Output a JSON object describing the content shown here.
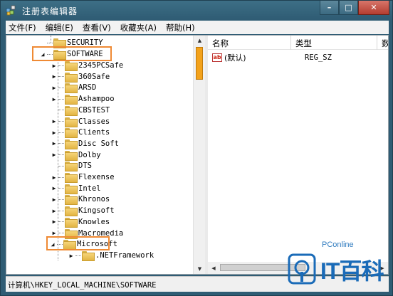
{
  "window": {
    "title": "注册表编辑器",
    "min_glyph": "–",
    "max_glyph": "□",
    "close_glyph": "✕"
  },
  "menu": [
    "文件(F)",
    "编辑(E)",
    "查看(V)",
    "收藏夹(A)",
    "帮助(H)"
  ],
  "tree": {
    "above": {
      "label": "SECURITY"
    },
    "software": {
      "label": "SOFTWARE",
      "expander": "◢"
    },
    "children": [
      "2345PCSafe",
      "360Safe",
      "ARSD",
      "Ashampoo",
      "CBSTEST",
      "Classes",
      "Clients",
      "Disc Soft",
      "Dolby",
      "DTS",
      "Flexense",
      "Intel",
      "Khronos",
      "Kingsoft",
      "Knowles",
      "Macromedia"
    ],
    "no_expander": [
      "CBSTEST",
      "DTS"
    ],
    "microsoft": {
      "label": "Microsoft",
      "expander": "◢"
    },
    "microsoft_child": ".NETFramework"
  },
  "list": {
    "columns": [
      "名称",
      "类型",
      "数"
    ],
    "rows": [
      {
        "icon": "ab",
        "name": "(默认)",
        "type": "REG_SZ"
      }
    ]
  },
  "status": {
    "path": "计算机\\HKEY_LOCAL_MACHINE\\SOFTWARE"
  },
  "watermark": {
    "small": "PConline",
    "big": "IT百科"
  },
  "colors": {
    "highlight_box": "#ef8a34",
    "scroll_thumb": "#f3a21b",
    "title_bar": "#2f5c74"
  }
}
